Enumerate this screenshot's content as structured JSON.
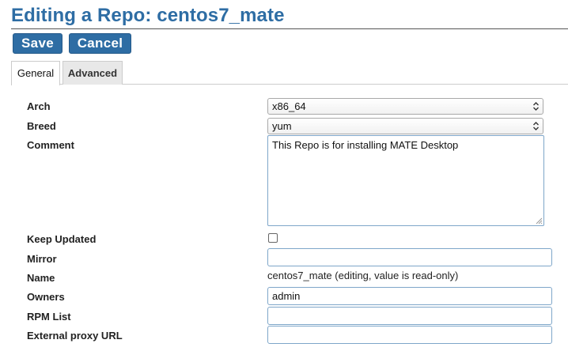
{
  "page": {
    "title": "Editing a Repo: centos7_mate"
  },
  "toolbar": {
    "save_label": "Save",
    "cancel_label": "Cancel"
  },
  "tabs": [
    {
      "label": "General",
      "active": true
    },
    {
      "label": "Advanced",
      "active": false
    }
  ],
  "form": {
    "arch": {
      "label": "Arch",
      "value": "x86_64"
    },
    "breed": {
      "label": "Breed",
      "value": "yum"
    },
    "comment": {
      "label": "Comment",
      "value": "This Repo is for installing MATE Desktop"
    },
    "keep_updated": {
      "label": "Keep Updated",
      "checked": false
    },
    "mirror": {
      "label": "Mirror",
      "value": ""
    },
    "name": {
      "label": "Name",
      "value": "centos7_mate (editing, value is read-only)"
    },
    "owners": {
      "label": "Owners",
      "value": "admin"
    },
    "rpm_list": {
      "label": "RPM List",
      "value": ""
    },
    "proxy_url": {
      "label": "External proxy URL",
      "value": ""
    }
  },
  "colors": {
    "accent": "#2e6da4",
    "input_border": "#7ea6c9"
  },
  "icons": {
    "select_arrows": "updown-chevron-icon",
    "resize_grip": "resize-grip-icon"
  }
}
